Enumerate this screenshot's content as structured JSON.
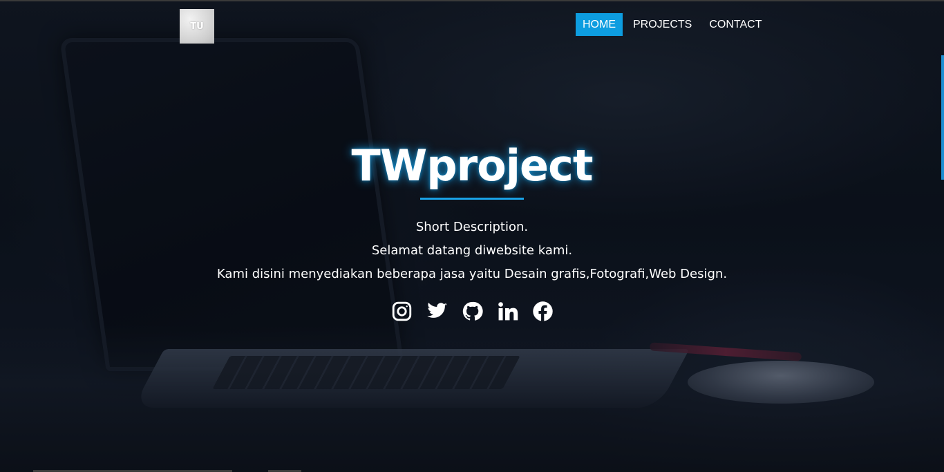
{
  "header": {
    "logo_text": "TU",
    "nav": [
      {
        "label": "HOME",
        "active": true
      },
      {
        "label": "PROJECTS",
        "active": false
      },
      {
        "label": "CONTACT",
        "active": false
      }
    ]
  },
  "hero": {
    "title": "TWproject",
    "description_lines": [
      "Short Description.",
      "Selamat datang diwebsite kami.",
      "Kami disini menyediakan beberapa jasa yaitu Desain grafis,Fotografi,Web Design."
    ],
    "socials": [
      {
        "icon": "instagram-icon"
      },
      {
        "icon": "twitter-icon"
      },
      {
        "icon": "github-icon"
      },
      {
        "icon": "linkedin-icon"
      },
      {
        "icon": "facebook-icon"
      }
    ]
  },
  "colors": {
    "accent": "#0d9de0",
    "text": "#ffffff",
    "glow": "#1aa3e8"
  }
}
